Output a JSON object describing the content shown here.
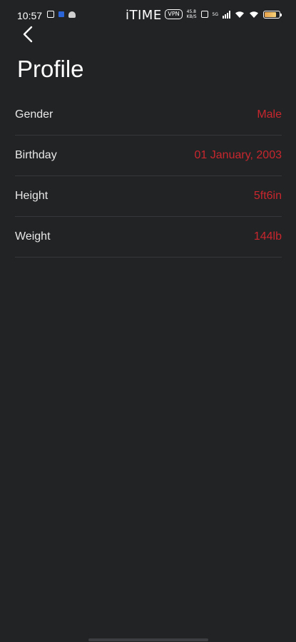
{
  "status_bar": {
    "time": "10:57",
    "brand": "iTIME",
    "vpn_label": "VPN",
    "network_speed_top": "45.8",
    "network_speed_bottom": "KB/S",
    "network_type": "5G",
    "battery_level_fraction": 0.8
  },
  "header": {
    "back_icon": "chevron-left-icon",
    "title": "Profile"
  },
  "profile": {
    "rows": [
      {
        "label": "Gender",
        "value": "Male"
      },
      {
        "label": "Birthday",
        "value": "01 January, 2003"
      },
      {
        "label": "Height",
        "value": "5ft6in"
      },
      {
        "label": "Weight",
        "value": "144lb"
      }
    ]
  },
  "colors": {
    "background": "#222325",
    "accent": "#c8272e",
    "divider": "#36373a",
    "text": "#ffffff"
  }
}
